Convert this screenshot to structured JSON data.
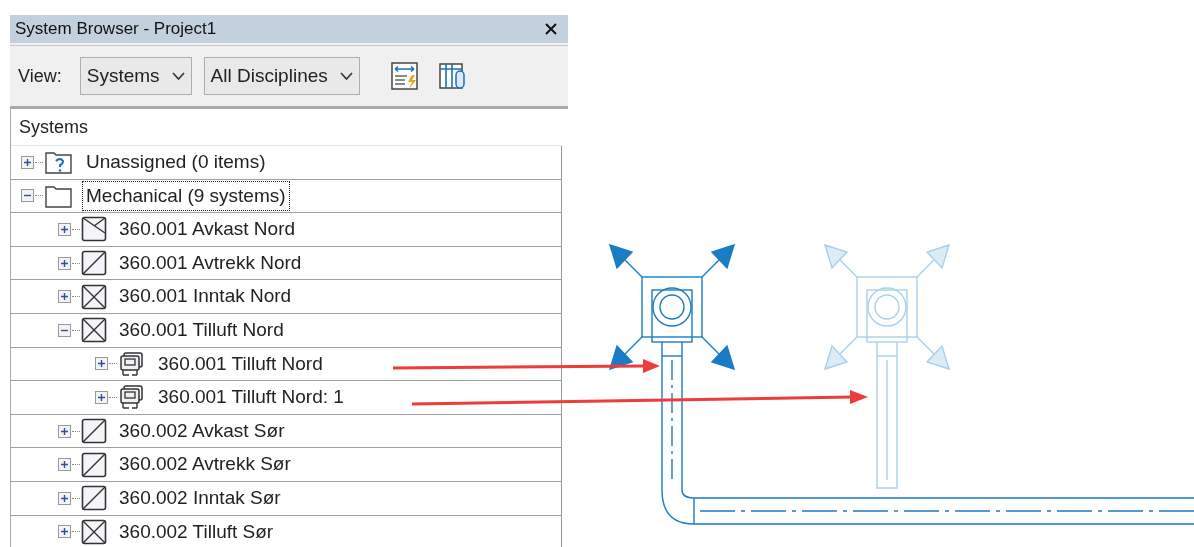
{
  "panel": {
    "title": "System Browser - Project1"
  },
  "toolbar": {
    "view_label": "View:",
    "dropdowns": [
      {
        "value": "Systems"
      },
      {
        "value": "All Disciplines"
      }
    ]
  },
  "tree": {
    "column": "Systems",
    "items": [
      {
        "label": "Unassigned (0 items)",
        "kind": "unassigned",
        "expanded": false,
        "focused": false
      },
      {
        "label": "Mechanical (9 systems)",
        "kind": "folder",
        "expanded": true,
        "focused": true,
        "children": [
          {
            "label": "360.001 Avkast Nord",
            "kind": "exhaust",
            "expanded": false,
            "focused": false
          },
          {
            "label": "360.001 Avtrekk Nord",
            "kind": "slash",
            "expanded": false,
            "focused": false
          },
          {
            "label": "360.001 Inntak Nord",
            "kind": "cross",
            "expanded": false,
            "focused": false
          },
          {
            "label": "360.001 Tilluft Nord",
            "kind": "cross",
            "expanded": true,
            "focused": false,
            "children": [
              {
                "label": "360.001 Tilluft Nord",
                "kind": "network",
                "expanded": false,
                "focused": false
              },
              {
                "label": "360.001 Tilluft Nord: 1",
                "kind": "network",
                "expanded": false,
                "focused": false
              }
            ]
          },
          {
            "label": "360.002 Avkast Sør",
            "kind": "slash",
            "expanded": false,
            "focused": false
          },
          {
            "label": "360.002 Avtrekk Sør",
            "kind": "slash",
            "expanded": false,
            "focused": false
          },
          {
            "label": "360.002 Inntak Sør",
            "kind": "slash",
            "expanded": false,
            "focused": false
          },
          {
            "label": "360.002 Tilluft Sør",
            "kind": "cross",
            "expanded": false,
            "focused": false
          }
        ]
      }
    ]
  }
}
